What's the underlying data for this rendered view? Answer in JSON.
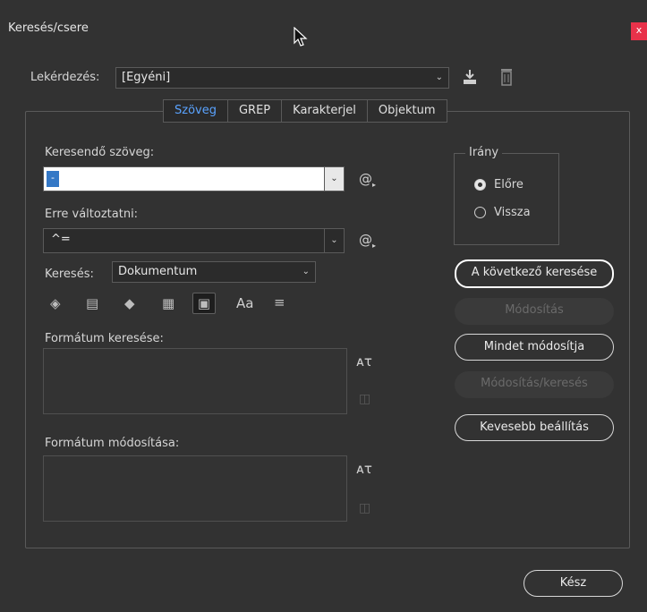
{
  "window": {
    "title": "Keresés/csere",
    "close_label": "x"
  },
  "query": {
    "label": "Lekérdezés:",
    "value": "[Egyéni]"
  },
  "tabs": [
    {
      "label": "Szöveg",
      "active": true
    },
    {
      "label": "GREP",
      "active": false
    },
    {
      "label": "Karakterjel",
      "active": false
    },
    {
      "label": "Objektum",
      "active": false
    }
  ],
  "find": {
    "label": "Keresendő szöveg:",
    "value": "-"
  },
  "change": {
    "label": "Erre változtatni:",
    "value": "^="
  },
  "search": {
    "label": "Keresés:",
    "value": "Dokumentum"
  },
  "options_icons": [
    "locked-layers-icon",
    "locked-stories-icon",
    "hidden-layers-icon",
    "master-pages-icon",
    "footnotes-icon",
    "case-sensitive-icon",
    "whole-word-icon"
  ],
  "case_label": "Aa",
  "find_format": {
    "label": "Formátum keresése:"
  },
  "change_format": {
    "label": "Formátum módosítása:"
  },
  "direction": {
    "label": "Irány",
    "options": [
      {
        "label": "Előre",
        "checked": true
      },
      {
        "label": "Vissza",
        "checked": false
      }
    ]
  },
  "buttons": {
    "find_next": "A következő keresése",
    "change": "Módosítás",
    "change_all": "Mindet módosítja",
    "change_find": "Módosítás/keresés",
    "fewer_options": "Kevesebb beállítás",
    "done": "Kész"
  },
  "colors": {
    "accent": "#5aa3ff",
    "close": "#e8324a",
    "selection": "#3478c6"
  }
}
